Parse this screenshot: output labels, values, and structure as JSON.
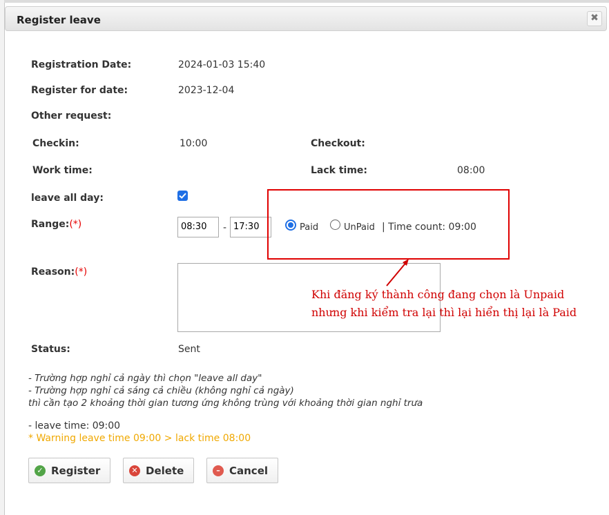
{
  "dialog": {
    "title": "Register leave",
    "close_symbol": "✖"
  },
  "form": {
    "registration_date_label": "Registration Date:",
    "registration_date_value": "2024-01-03 15:40",
    "register_for_date_label": "Register for date:",
    "register_for_date_value": "2023-12-04",
    "other_request_label": "Other request:",
    "checkin_label": "Checkin:",
    "checkin_value": "10:00",
    "checkout_label": "Checkout:",
    "work_time_label": "Work time:",
    "lack_time_label": "Lack time:",
    "lack_time_value": "08:00",
    "leave_all_day_label": "leave all day:",
    "leave_all_day_checked": true,
    "range_label": "Range:",
    "required_mark": "(*)",
    "range_from": "08:30",
    "range_separator": "-",
    "range_to": "17:30",
    "paid_label": "Paid",
    "unpaid_label": "UnPaid",
    "selected_pay_type": "Paid",
    "time_count_text": "| Time count: 09:00",
    "reason_label": "Reason:",
    "reason_value": "",
    "status_label": "Status:",
    "status_value": "Sent"
  },
  "annotation": {
    "line1": "Khi đăng ký thành công đang chọn là Unpaid",
    "line2": "nhưng khi kiểm tra lại thì lại hiển thị lại là Paid",
    "color": "#d00000"
  },
  "notes": {
    "line1": "- Trường hợp nghỉ cả ngày thì chọn \"leave all day\"",
    "line2": "- Trường hợp nghỉ cả sáng cả chiều (không nghỉ cả ngày)",
    "line3": "thì cần tạo 2 khoảng thời gian tương ứng không trùng với khoảng thời gian nghỉ trưa",
    "leave_time": "- leave time: 09:00",
    "warning": "* Warning leave time 09:00 > lack time 08:00",
    "warning_color": "#f0a800"
  },
  "buttons": {
    "register_label": "Register",
    "delete_label": "Delete",
    "cancel_label": "Cancel",
    "register_icon": "check-circle-icon",
    "delete_icon": "x-circle-icon",
    "cancel_icon": "minus-circle-icon"
  }
}
